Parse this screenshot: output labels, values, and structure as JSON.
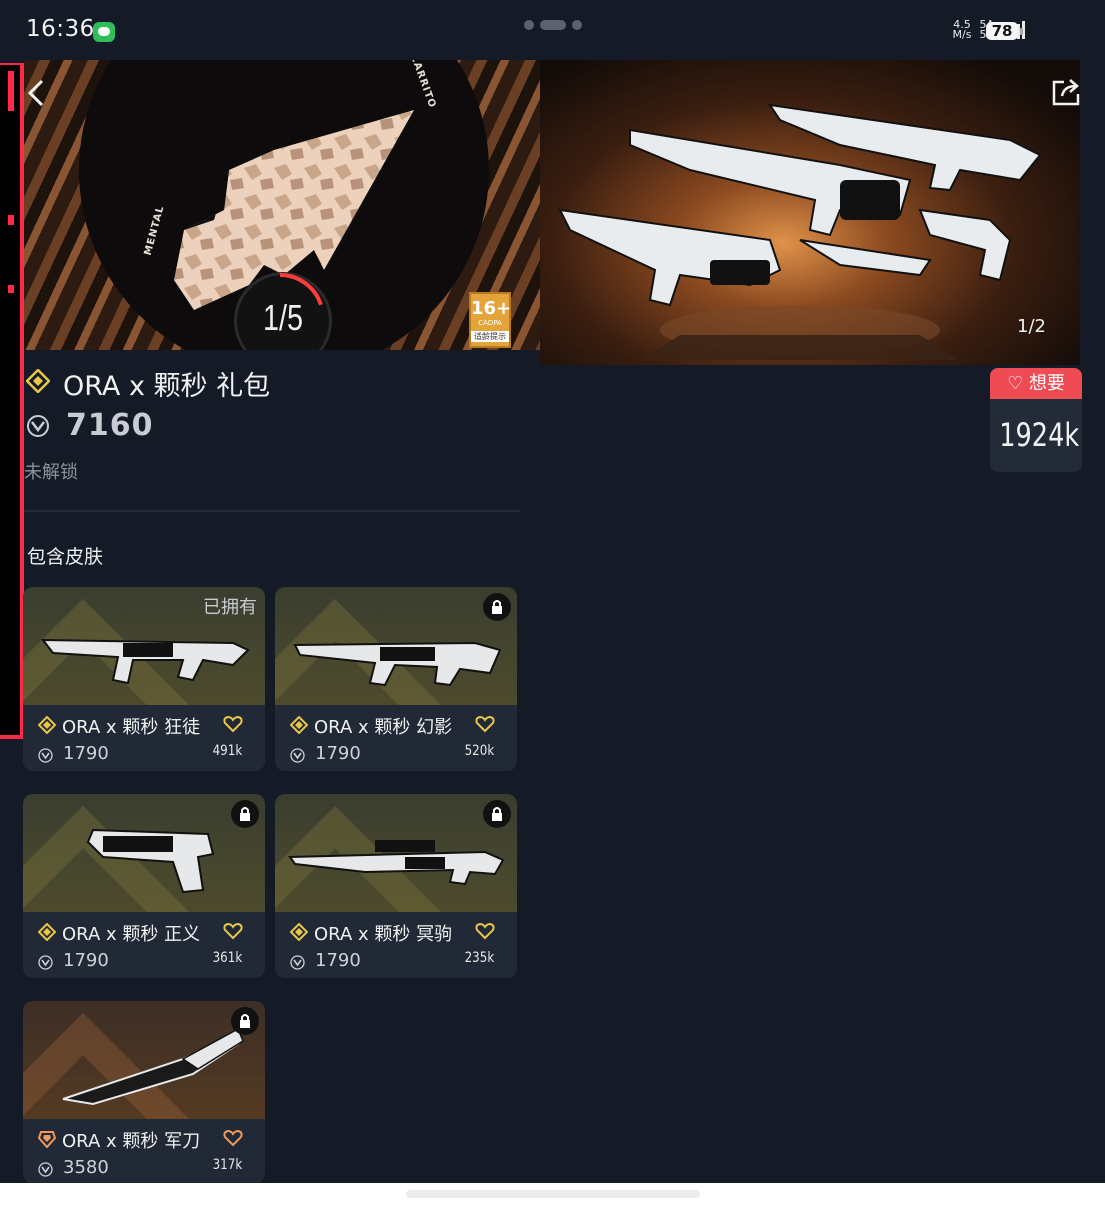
{
  "status_bar": {
    "time": "16:36",
    "net_speed_value": "4.5",
    "net_speed_unit": "M/s",
    "sim1": "5A",
    "sim2": "5A",
    "battery": "78"
  },
  "hero": {
    "counter": "1/5",
    "age_rating": "16+",
    "age_org": "CADPA",
    "age_label": "适龄提示",
    "image_counter": "1/2"
  },
  "want": {
    "label": "想要",
    "count": "1924k"
  },
  "bundle": {
    "title": "ORA x 颗秒 礼包",
    "price": "7160",
    "status": "未解锁",
    "section_title": "包含皮肤"
  },
  "skins": [
    {
      "name": "ORA x 颗秒 狂徒",
      "price": "1790",
      "likes": "491k",
      "owned_label": "已拥有",
      "tier_color": "#e8c64a"
    },
    {
      "name": "ORA x 颗秒 幻影",
      "price": "1790",
      "likes": "520k",
      "tier_color": "#e8c64a"
    },
    {
      "name": "ORA x 颗秒 正义",
      "price": "1790",
      "likes": "361k",
      "tier_color": "#e8c64a"
    },
    {
      "name": "ORA x 颗秒 冥驹",
      "price": "1790",
      "likes": "235k",
      "tier_color": "#e8c64a"
    },
    {
      "name": "ORA x 颗秒 军刀",
      "price": "3580",
      "likes": "317k",
      "tier_color": "#f09a5c"
    }
  ],
  "colors": {
    "accent_red": "#ef4b55",
    "rail_red": "#ff2a48",
    "tier_gold": "#e8c64a",
    "background": "#141b27"
  }
}
